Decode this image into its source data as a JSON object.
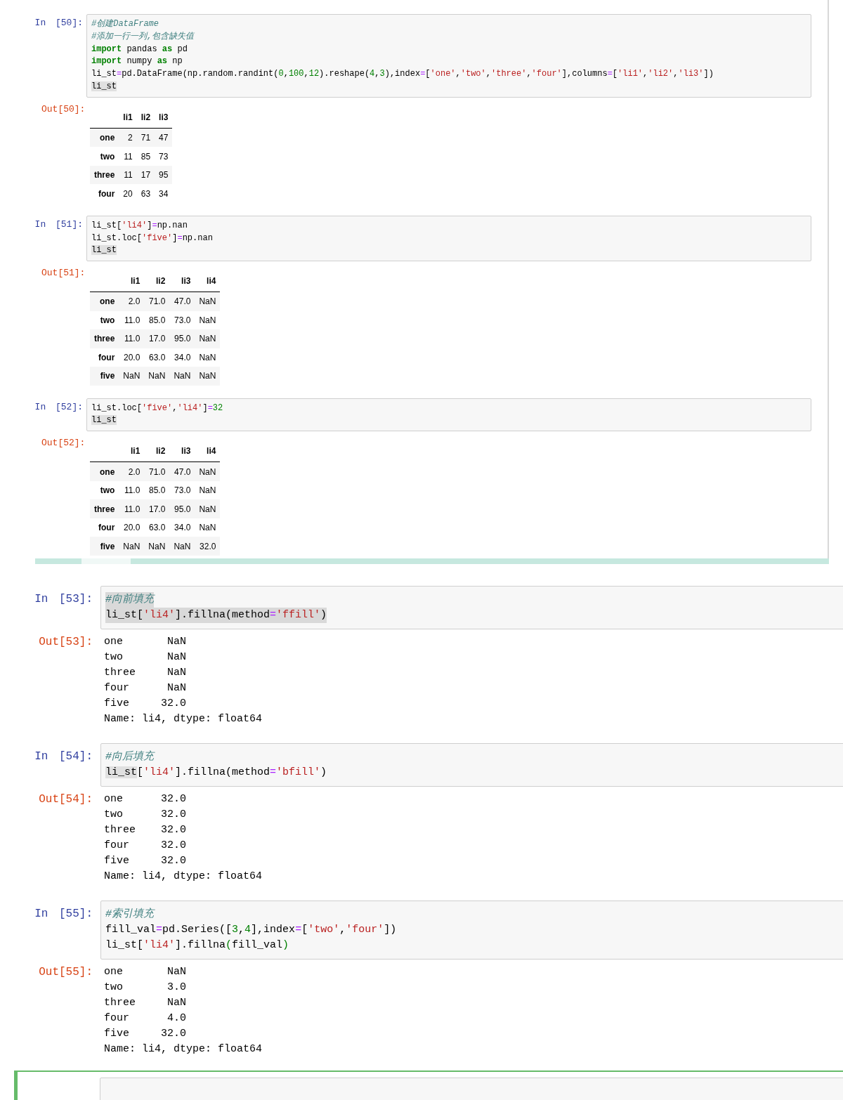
{
  "panels": [
    {
      "cells": [
        {
          "selected": false,
          "prompt_in": "In [50]:",
          "code": [
            {
              "highlighted": false,
              "tokens": [
                {
                  "kind": "comment",
                  "text": "#创建DataFrame"
                }
              ]
            },
            {
              "highlighted": false,
              "tokens": [
                {
                  "kind": "comment",
                  "text": "#添加一行一列,包含缺失值"
                }
              ]
            },
            {
              "highlighted": false,
              "tokens": [
                {
                  "kind": "kw",
                  "text": "import"
                },
                {
                  "kind": "plain",
                  "text": " pandas "
                },
                {
                  "kind": "kw",
                  "text": "as"
                },
                {
                  "kind": "plain",
                  "text": " pd"
                }
              ]
            },
            {
              "highlighted": false,
              "tokens": [
                {
                  "kind": "kw",
                  "text": "import"
                },
                {
                  "kind": "plain",
                  "text": " numpy "
                },
                {
                  "kind": "kw",
                  "text": "as"
                },
                {
                  "kind": "plain",
                  "text": " np"
                }
              ]
            },
            {
              "highlighted": false,
              "tokens": [
                {
                  "kind": "plain",
                  "text": "li_st"
                },
                {
                  "kind": "op",
                  "text": "="
                },
                {
                  "kind": "plain",
                  "text": "pd.DataFrame(np.random.randint("
                },
                {
                  "kind": "num",
                  "text": "0"
                },
                {
                  "kind": "plain",
                  "text": ","
                },
                {
                  "kind": "num",
                  "text": "100"
                },
                {
                  "kind": "plain",
                  "text": ","
                },
                {
                  "kind": "num",
                  "text": "12"
                },
                {
                  "kind": "plain",
                  "text": ").reshape("
                },
                {
                  "kind": "num",
                  "text": "4"
                },
                {
                  "kind": "plain",
                  "text": ","
                },
                {
                  "kind": "num",
                  "text": "3"
                },
                {
                  "kind": "plain",
                  "text": "),index"
                },
                {
                  "kind": "op",
                  "text": "="
                },
                {
                  "kind": "plain",
                  "text": "["
                },
                {
                  "kind": "str",
                  "text": "'one'"
                },
                {
                  "kind": "plain",
                  "text": ","
                },
                {
                  "kind": "str",
                  "text": "'two'"
                },
                {
                  "kind": "plain",
                  "text": ","
                },
                {
                  "kind": "str",
                  "text": "'three'"
                },
                {
                  "kind": "plain",
                  "text": ","
                },
                {
                  "kind": "str",
                  "text": "'four'"
                },
                {
                  "kind": "plain",
                  "text": "],columns"
                },
                {
                  "kind": "op",
                  "text": "="
                },
                {
                  "kind": "plain",
                  "text": "["
                },
                {
                  "kind": "str",
                  "text": "'li1'"
                },
                {
                  "kind": "plain",
                  "text": ","
                },
                {
                  "kind": "str",
                  "text": "'li2'"
                },
                {
                  "kind": "plain",
                  "text": ","
                },
                {
                  "kind": "str",
                  "text": "'li3'"
                },
                {
                  "kind": "plain",
                  "text": "])"
                }
              ]
            },
            {
              "highlighted": false,
              "tokens": [
                {
                  "kind": "match",
                  "text": "li_st"
                }
              ]
            }
          ],
          "prompt_out": "Out[50]:",
          "output": {
            "kind": "table",
            "columns": [
              "li1",
              "li2",
              "li3"
            ],
            "rows": [
              {
                "label": "one",
                "cells": [
                  "2",
                  "71",
                  "47"
                ]
              },
              {
                "label": "two",
                "cells": [
                  "11",
                  "85",
                  "73"
                ]
              },
              {
                "label": "three",
                "cells": [
                  "11",
                  "17",
                  "95"
                ]
              },
              {
                "label": "four",
                "cells": [
                  "20",
                  "63",
                  "34"
                ]
              }
            ]
          }
        },
        {
          "selected": false,
          "prompt_in": "In [51]:",
          "code": [
            {
              "highlighted": false,
              "tokens": [
                {
                  "kind": "plain",
                  "text": "li_st["
                },
                {
                  "kind": "str",
                  "text": "'li4'"
                },
                {
                  "kind": "plain",
                  "text": "]"
                },
                {
                  "kind": "op",
                  "text": "="
                },
                {
                  "kind": "plain",
                  "text": "np.nan"
                }
              ]
            },
            {
              "highlighted": false,
              "tokens": [
                {
                  "kind": "plain",
                  "text": "li_st.loc["
                },
                {
                  "kind": "str",
                  "text": "'five'"
                },
                {
                  "kind": "plain",
                  "text": "]"
                },
                {
                  "kind": "op",
                  "text": "="
                },
                {
                  "kind": "plain",
                  "text": "np.nan"
                }
              ]
            },
            {
              "highlighted": false,
              "tokens": [
                {
                  "kind": "match",
                  "text": "li_st"
                }
              ]
            }
          ],
          "prompt_out": "Out[51]:",
          "output": {
            "kind": "table",
            "columns": [
              "li1",
              "li2",
              "li3",
              "li4"
            ],
            "rows": [
              {
                "label": "one",
                "cells": [
                  "2.0",
                  "71.0",
                  "47.0",
                  "NaN"
                ]
              },
              {
                "label": "two",
                "cells": [
                  "11.0",
                  "85.0",
                  "73.0",
                  "NaN"
                ]
              },
              {
                "label": "three",
                "cells": [
                  "11.0",
                  "17.0",
                  "95.0",
                  "NaN"
                ]
              },
              {
                "label": "four",
                "cells": [
                  "20.0",
                  "63.0",
                  "34.0",
                  "NaN"
                ]
              },
              {
                "label": "five",
                "cells": [
                  "NaN",
                  "NaN",
                  "NaN",
                  "NaN"
                ]
              }
            ]
          }
        },
        {
          "selected": false,
          "prompt_in": "In [52]:",
          "code": [
            {
              "highlighted": false,
              "tokens": [
                {
                  "kind": "plain",
                  "text": "li_st.loc["
                },
                {
                  "kind": "str",
                  "text": "'five'"
                },
                {
                  "kind": "plain",
                  "text": ","
                },
                {
                  "kind": "str",
                  "text": "'li4'"
                },
                {
                  "kind": "plain",
                  "text": "]"
                },
                {
                  "kind": "op",
                  "text": "="
                },
                {
                  "kind": "num",
                  "text": "32"
                }
              ]
            },
            {
              "highlighted": false,
              "tokens": [
                {
                  "kind": "match",
                  "text": "li_st"
                }
              ]
            }
          ],
          "prompt_out": "Out[52]:",
          "output": {
            "kind": "table",
            "columns": [
              "li1",
              "li2",
              "li3",
              "li4"
            ],
            "rows": [
              {
                "label": "one",
                "cells": [
                  "2.0",
                  "71.0",
                  "47.0",
                  "NaN"
                ]
              },
              {
                "label": "two",
                "cells": [
                  "11.0",
                  "85.0",
                  "73.0",
                  "NaN"
                ]
              },
              {
                "label": "three",
                "cells": [
                  "11.0",
                  "17.0",
                  "95.0",
                  "NaN"
                ]
              },
              {
                "label": "four",
                "cells": [
                  "20.0",
                  "63.0",
                  "34.0",
                  "NaN"
                ]
              },
              {
                "label": "five",
                "cells": [
                  "NaN",
                  "NaN",
                  "NaN",
                  "32.0"
                ]
              }
            ]
          }
        }
      ]
    },
    {
      "cells": [
        {
          "selected": false,
          "prompt_in": "In [53]:",
          "code": [
            {
              "highlighted": true,
              "tokens": [
                {
                  "kind": "comment",
                  "text": "#向前填充"
                }
              ]
            },
            {
              "highlighted": true,
              "tokens": [
                {
                  "kind": "plain",
                  "text": "li_st["
                },
                {
                  "kind": "str",
                  "text": "'li4'"
                },
                {
                  "kind": "plain",
                  "text": "].fillna(method"
                },
                {
                  "kind": "op",
                  "text": "="
                },
                {
                  "kind": "str",
                  "text": "'ffill'"
                },
                {
                  "kind": "plain",
                  "text": ")"
                }
              ]
            }
          ],
          "prompt_out": "Out[53]:",
          "output": {
            "kind": "text",
            "lines": [
              "one       NaN",
              "two       NaN",
              "three     NaN",
              "four      NaN",
              "five     32.0",
              "Name: li4, dtype: float64"
            ]
          }
        },
        {
          "selected": false,
          "prompt_in": "In [54]:",
          "code": [
            {
              "highlighted": false,
              "tokens": [
                {
                  "kind": "comment",
                  "text": "#向后填充"
                }
              ]
            },
            {
              "highlighted": false,
              "tokens": [
                {
                  "kind": "match",
                  "text": "li_st"
                },
                {
                  "kind": "plain",
                  "text": "["
                },
                {
                  "kind": "str",
                  "text": "'li4'"
                },
                {
                  "kind": "plain",
                  "text": "].fillna(method"
                },
                {
                  "kind": "op",
                  "text": "="
                },
                {
                  "kind": "str",
                  "text": "'bfill'"
                },
                {
                  "kind": "plain",
                  "text": ")"
                }
              ]
            }
          ],
          "prompt_out": "Out[54]:",
          "output": {
            "kind": "text",
            "lines": [
              "one      32.0",
              "two      32.0",
              "three    32.0",
              "four     32.0",
              "five     32.0",
              "Name: li4, dtype: float64"
            ]
          }
        },
        {
          "selected": false,
          "prompt_in": "In [55]:",
          "code": [
            {
              "highlighted": false,
              "tokens": [
                {
                  "kind": "comment",
                  "text": "#索引填充"
                }
              ]
            },
            {
              "highlighted": false,
              "tokens": [
                {
                  "kind": "plain",
                  "text": "fill_val"
                },
                {
                  "kind": "op",
                  "text": "="
                },
                {
                  "kind": "plain",
                  "text": "pd.Series(["
                },
                {
                  "kind": "num",
                  "text": "3"
                },
                {
                  "kind": "plain",
                  "text": ","
                },
                {
                  "kind": "num",
                  "text": "4"
                },
                {
                  "kind": "plain",
                  "text": "],index"
                },
                {
                  "kind": "op",
                  "text": "="
                },
                {
                  "kind": "plain",
                  "text": "["
                },
                {
                  "kind": "str",
                  "text": "'two'"
                },
                {
                  "kind": "plain",
                  "text": ","
                },
                {
                  "kind": "str",
                  "text": "'four'"
                },
                {
                  "kind": "plain",
                  "text": "])"
                }
              ]
            },
            {
              "highlighted": false,
              "tokens": [
                {
                  "kind": "plain",
                  "text": "li_st["
                },
                {
                  "kind": "str",
                  "text": "'li4'"
                },
                {
                  "kind": "plain",
                  "text": "].fillna"
                },
                {
                  "kind": "bracket",
                  "text": "("
                },
                {
                  "kind": "plain",
                  "text": "fill_val"
                },
                {
                  "kind": "bracket",
                  "text": ")"
                }
              ]
            }
          ],
          "prompt_out": "Out[55]:",
          "output": {
            "kind": "text",
            "lines": [
              "one       NaN",
              "two       3.0",
              "three     NaN",
              "four      4.0",
              "five     32.0",
              "Name: li4, dtype: float64"
            ]
          }
        },
        {
          "selected": true
        }
      ]
    }
  ]
}
